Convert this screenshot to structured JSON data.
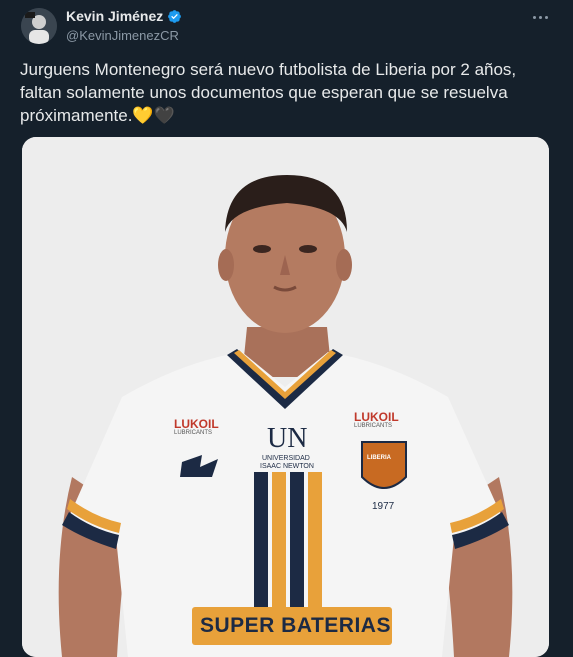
{
  "author": {
    "display_name": "Kevin Jiménez",
    "handle": "@KevinJimenezCR",
    "verified": true,
    "avatar_icon": "avatar-photo"
  },
  "more_icon": "more-options-icon",
  "tweet": {
    "text": "Jurguens Montenegro será nuevo futbolista de Liberia por 2 años, faltan solamente unos documentos que esperan que se resuelva próximamente.💛🖤"
  },
  "media": {
    "description_icon": "player-photo",
    "jersey": {
      "sponsor_left": "LUKOIL",
      "sponsor_left_sub": "LUBRICANTS",
      "sponsor_right": "LUKOIL",
      "sponsor_right_sub": "LUBRICANTS",
      "university_logo": "UN",
      "university_line1": "UNIVERSIDAD",
      "university_line2": "ISAAC NEWTON",
      "crest_text": "LIBERIA",
      "crest_year": "1977",
      "chest_sponsor": "SUPER BATERIAS"
    }
  },
  "colors": {
    "background": "#15202b",
    "verified_blue": "#1d9bf0",
    "jersey_navy": "#1c2a44",
    "jersey_gold": "#e8a13a"
  }
}
